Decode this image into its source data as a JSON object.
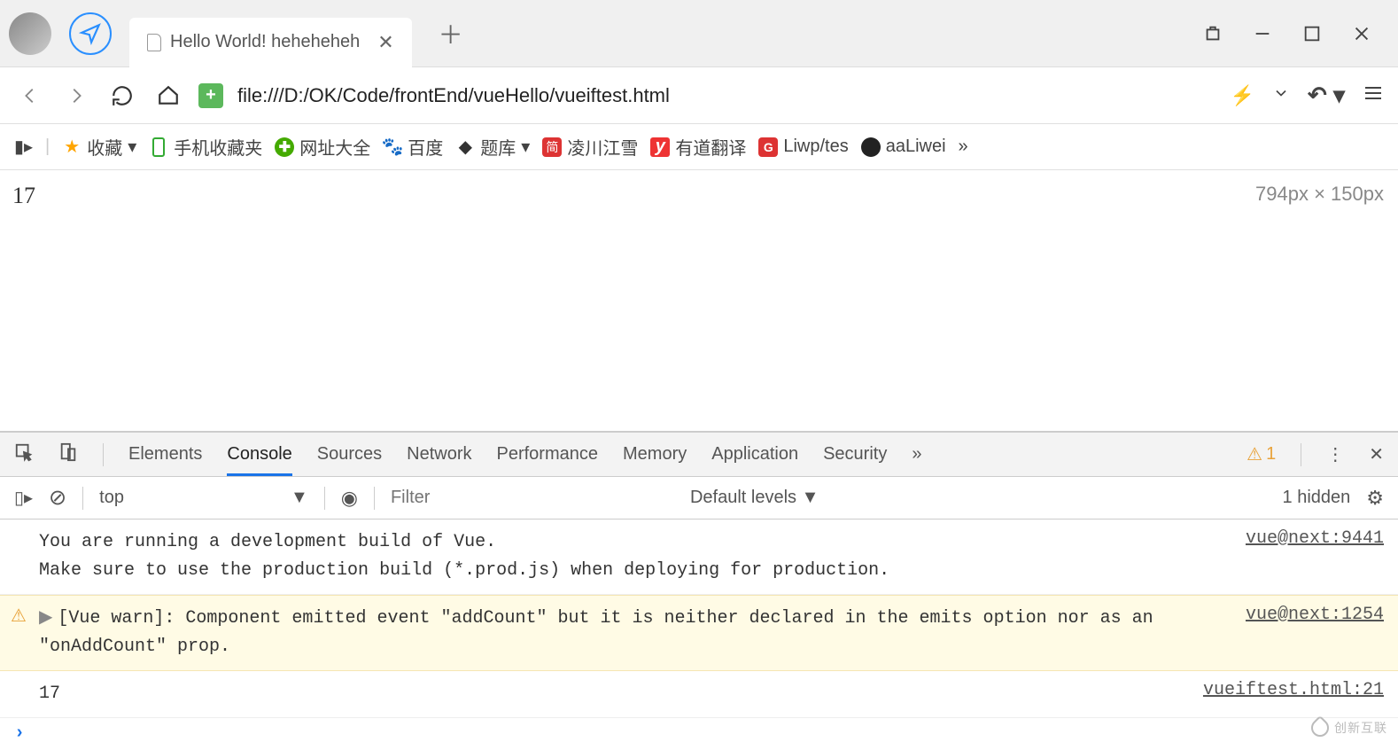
{
  "tab": {
    "title": "Hello World! heheheheh"
  },
  "url": "file:///D:/OK/Code/frontEnd/vueHello/vueiftest.html",
  "bookmarks": {
    "fav": "收藏",
    "mobile": "手机收藏夹",
    "sites": "网址大全",
    "baidu": "百度",
    "tiku": "题库",
    "lingchuan": "凌川江雪",
    "youdao": "有道翻译",
    "liwp": "Liwp/tes",
    "aaliwei": "aaLiwei",
    "more": "»"
  },
  "page": {
    "value": "17",
    "sizeLabel": "794px × 150px"
  },
  "devtools": {
    "tabs": {
      "elements": "Elements",
      "console": "Console",
      "sources": "Sources",
      "network": "Network",
      "performance": "Performance",
      "memory": "Memory",
      "application": "Application",
      "security": "Security",
      "more": "»"
    },
    "warnCount": "1",
    "toolbar": {
      "context": "top",
      "filterPlaceholder": "Filter",
      "levels": "Default levels ▼",
      "hidden": "1 hidden"
    },
    "logs": [
      {
        "kind": "info",
        "msg": "You are running a development build of Vue.\nMake sure to use the production build (*.prod.js) when deploying for production.",
        "src": "vue@next:9441"
      },
      {
        "kind": "warn",
        "msg": "[Vue warn]: Component emitted event \"addCount\" but it is neither declared in the emits option nor as an \"onAddCount\" prop.",
        "src": "vue@next:1254"
      },
      {
        "kind": "log",
        "msg": "17",
        "src": "vueiftest.html:21"
      }
    ]
  },
  "watermark": "创新互联"
}
